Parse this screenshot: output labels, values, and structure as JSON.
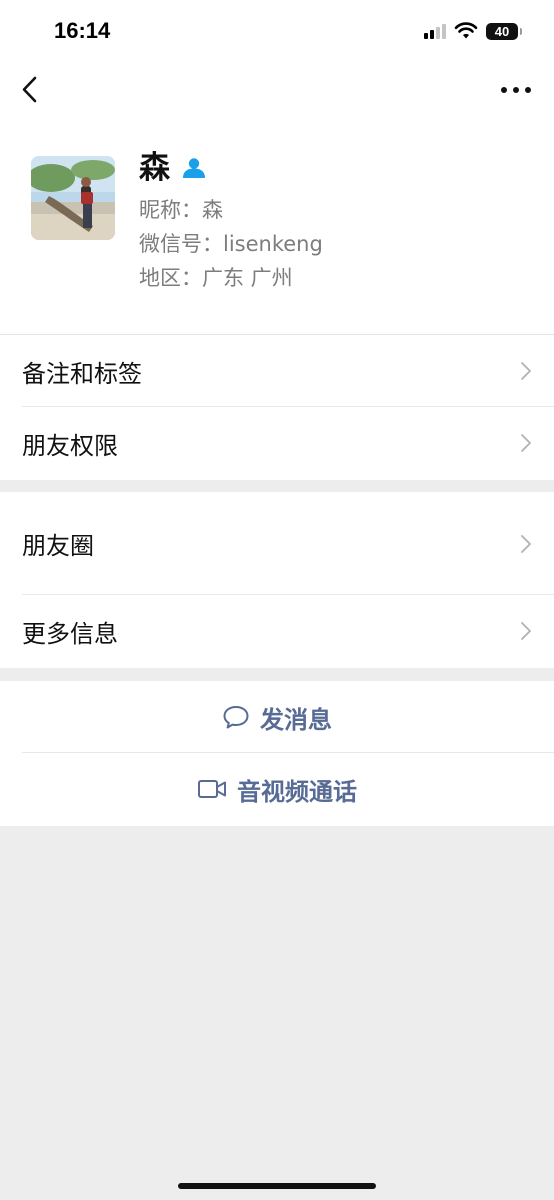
{
  "status_bar": {
    "time": "16:14",
    "battery": "40"
  },
  "nav": {
    "back_icon": "chevron-left-icon",
    "more_icon": "more-dots-icon"
  },
  "profile": {
    "name": "森",
    "badge_icon": "person-icon",
    "nickname": "昵称：森",
    "wechat_id": "微信号：lisenkeng",
    "region": "地区：广东 广州"
  },
  "section1": {
    "items": [
      {
        "label": "备注和标签"
      },
      {
        "label": "朋友权限"
      }
    ]
  },
  "section2": {
    "items": [
      {
        "label": "朋友圈"
      },
      {
        "label": "更多信息"
      }
    ]
  },
  "actions": {
    "message": {
      "label": "发消息",
      "icon": "chat-bubble-icon"
    },
    "call": {
      "label": "音视频通话",
      "icon": "video-camera-icon"
    }
  },
  "colors": {
    "link_blue": "#576b95",
    "badge_blue": "#1aa0e8",
    "background": "#ededed"
  }
}
